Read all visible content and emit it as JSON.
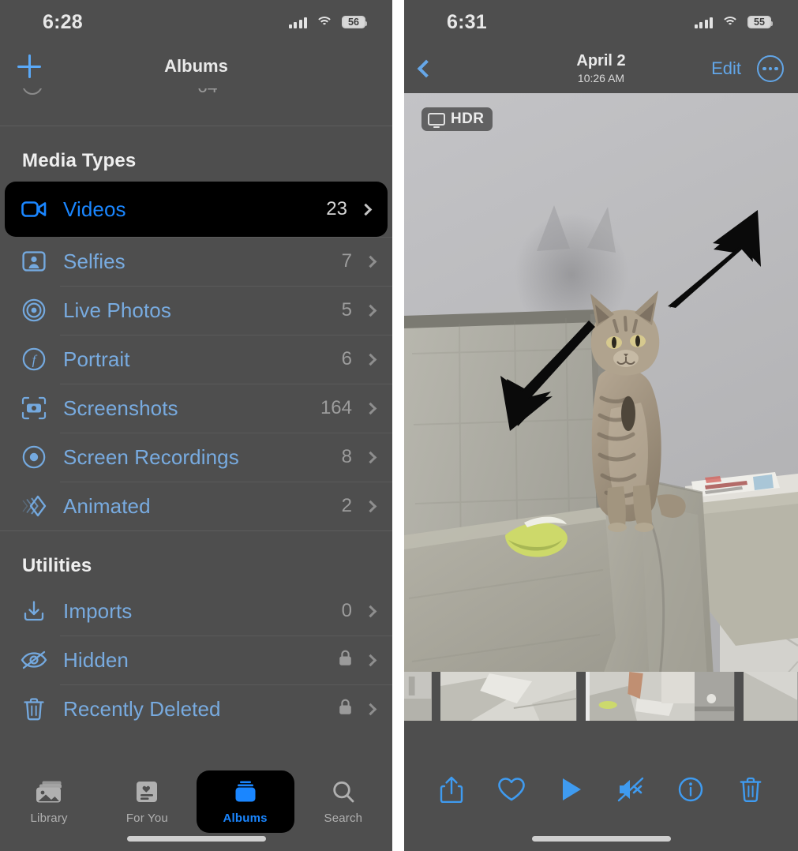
{
  "left_panel": {
    "status_bar": {
      "time": "6:28",
      "battery": "56",
      "signal_icon": "cellular-signal-icon",
      "wifi_icon": "wifi-icon",
      "battery_icon": "battery-icon"
    },
    "nav": {
      "add_icon": "plus-icon",
      "title": "Albums"
    },
    "sections": [
      {
        "title": "Media Types",
        "rows": [
          {
            "icon": "video-camera-icon",
            "label": "Videos",
            "count": "23",
            "selected": true
          },
          {
            "icon": "selfie-person-icon",
            "label": "Selfies",
            "count": "7",
            "selected": false
          },
          {
            "icon": "live-photo-icon",
            "label": "Live Photos",
            "count": "5",
            "selected": false
          },
          {
            "icon": "portrait-f-icon",
            "label": "Portrait",
            "count": "6",
            "selected": false
          },
          {
            "icon": "screenshot-icon",
            "label": "Screenshots",
            "count": "164",
            "selected": false
          },
          {
            "icon": "screen-record-icon",
            "label": "Screen Recordings",
            "count": "8",
            "selected": false
          },
          {
            "icon": "animated-icon",
            "label": "Animated",
            "count": "2",
            "selected": false
          }
        ]
      },
      {
        "title": "Utilities",
        "rows": [
          {
            "icon": "import-icon",
            "label": "Imports",
            "count": "0",
            "locked": false
          },
          {
            "icon": "eye-slash-icon",
            "label": "Hidden",
            "count": "",
            "locked": true
          },
          {
            "icon": "trash-icon",
            "label": "Recently Deleted",
            "count": "",
            "locked": true
          }
        ]
      }
    ],
    "tabbar": [
      {
        "icon": "library-photos-icon",
        "label": "Library",
        "active": false
      },
      {
        "icon": "for-you-card-icon",
        "label": "For You",
        "active": false
      },
      {
        "icon": "albums-stack-icon",
        "label": "Albums",
        "active": true
      },
      {
        "icon": "search-icon",
        "label": "Search",
        "active": false
      }
    ]
  },
  "right_panel": {
    "status_bar": {
      "time": "6:31",
      "battery": "55",
      "signal_icon": "cellular-signal-icon",
      "wifi_icon": "wifi-icon",
      "battery_icon": "battery-icon"
    },
    "nav": {
      "back_icon": "chevron-left-icon",
      "date": "April 2",
      "time": "10:26 AM",
      "edit_label": "Edit",
      "more_icon": "ellipsis-circle-icon"
    },
    "photo": {
      "hdr_badge": "HDR",
      "hdr_icon": "display-icon",
      "description": "Tabby cat sitting on the armrest of a grey fabric sofa, with two black annotation arrows overlaid"
    },
    "toolbar": [
      {
        "icon": "share-icon",
        "name": "share-button"
      },
      {
        "icon": "heart-icon",
        "name": "favorite-button"
      },
      {
        "icon": "play-icon",
        "name": "play-button"
      },
      {
        "icon": "mute-icon",
        "name": "mute-button"
      },
      {
        "icon": "info-icon",
        "name": "info-button"
      },
      {
        "icon": "trash-icon",
        "name": "delete-button"
      }
    ]
  },
  "colors": {
    "accent_blue": "#1a86ff",
    "link_blue": "#78abe0",
    "panel_bg": "#4e4e4e",
    "spotlight_bg": "#000000",
    "muted_text": "#9c9c9c"
  }
}
